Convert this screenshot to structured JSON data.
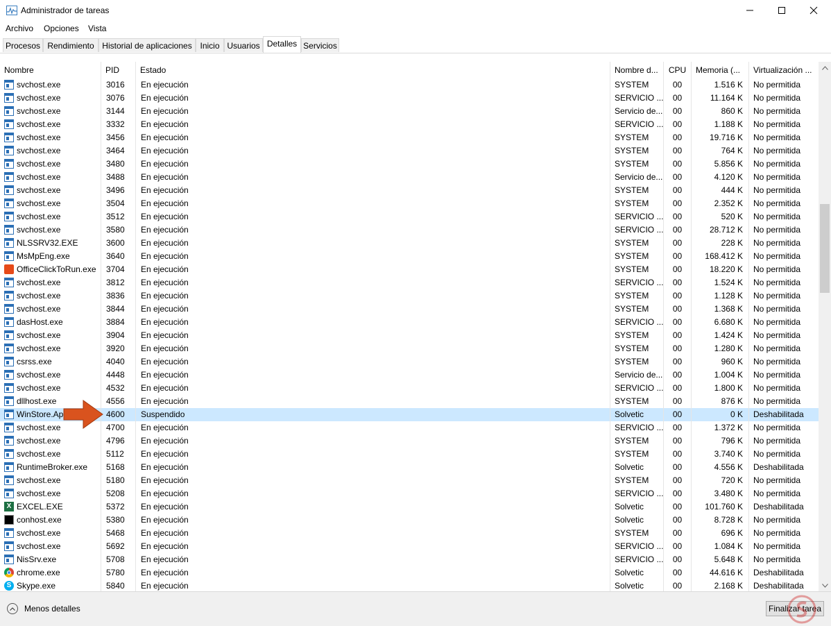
{
  "window": {
    "title": "Administrador de tareas",
    "minimize_glyph": "—",
    "maximize_glyph": "☐",
    "close_glyph": "✕"
  },
  "menu": [
    "Archivo",
    "Opciones",
    "Vista"
  ],
  "tabs": [
    {
      "label": "Procesos"
    },
    {
      "label": "Rendimiento"
    },
    {
      "label": "Historial de aplicaciones"
    },
    {
      "label": "Inicio"
    },
    {
      "label": "Usuarios"
    },
    {
      "label": "Detalles",
      "active": true
    },
    {
      "label": "Servicios"
    }
  ],
  "columns": {
    "name": "Nombre",
    "pid": "PID",
    "state": "Estado",
    "user": "Nombre d...",
    "cpu": "CPU",
    "memory": "Memoria (...",
    "virtualization": "Virtualización ..."
  },
  "rows": [
    {
      "name": "svchost.exe",
      "icon": "window",
      "pid": "3016",
      "state": "En ejecución",
      "user": "SYSTEM",
      "cpu": "00",
      "memory": "1.516 K",
      "virt": "No permitida"
    },
    {
      "name": "svchost.exe",
      "icon": "window",
      "pid": "3076",
      "state": "En ejecución",
      "user": "SERVICIO ...",
      "cpu": "00",
      "memory": "11.164 K",
      "virt": "No permitida"
    },
    {
      "name": "svchost.exe",
      "icon": "window",
      "pid": "3144",
      "state": "En ejecución",
      "user": "Servicio de...",
      "cpu": "00",
      "memory": "860 K",
      "virt": "No permitida"
    },
    {
      "name": "svchost.exe",
      "icon": "window",
      "pid": "3332",
      "state": "En ejecución",
      "user": "SERVICIO ...",
      "cpu": "00",
      "memory": "1.188 K",
      "virt": "No permitida"
    },
    {
      "name": "svchost.exe",
      "icon": "window",
      "pid": "3456",
      "state": "En ejecución",
      "user": "SYSTEM",
      "cpu": "00",
      "memory": "19.716 K",
      "virt": "No permitida"
    },
    {
      "name": "svchost.exe",
      "icon": "window",
      "pid": "3464",
      "state": "En ejecución",
      "user": "SYSTEM",
      "cpu": "00",
      "memory": "764 K",
      "virt": "No permitida"
    },
    {
      "name": "svchost.exe",
      "icon": "window",
      "pid": "3480",
      "state": "En ejecución",
      "user": "SYSTEM",
      "cpu": "00",
      "memory": "5.856 K",
      "virt": "No permitida"
    },
    {
      "name": "svchost.exe",
      "icon": "window",
      "pid": "3488",
      "state": "En ejecución",
      "user": "Servicio de...",
      "cpu": "00",
      "memory": "4.120 K",
      "virt": "No permitida"
    },
    {
      "name": "svchost.exe",
      "icon": "window",
      "pid": "3496",
      "state": "En ejecución",
      "user": "SYSTEM",
      "cpu": "00",
      "memory": "444 K",
      "virt": "No permitida"
    },
    {
      "name": "svchost.exe",
      "icon": "window",
      "pid": "3504",
      "state": "En ejecución",
      "user": "SYSTEM",
      "cpu": "00",
      "memory": "2.352 K",
      "virt": "No permitida"
    },
    {
      "name": "svchost.exe",
      "icon": "window",
      "pid": "3512",
      "state": "En ejecución",
      "user": "SERVICIO ...",
      "cpu": "00",
      "memory": "520 K",
      "virt": "No permitida"
    },
    {
      "name": "svchost.exe",
      "icon": "window",
      "pid": "3580",
      "state": "En ejecución",
      "user": "SERVICIO ...",
      "cpu": "00",
      "memory": "28.712 K",
      "virt": "No permitida"
    },
    {
      "name": "NLSSRV32.EXE",
      "icon": "window",
      "pid": "3600",
      "state": "En ejecución",
      "user": "SYSTEM",
      "cpu": "00",
      "memory": "228 K",
      "virt": "No permitida"
    },
    {
      "name": "MsMpEng.exe",
      "icon": "window",
      "pid": "3640",
      "state": "En ejecución",
      "user": "SYSTEM",
      "cpu": "00",
      "memory": "168.412 K",
      "virt": "No permitida"
    },
    {
      "name": "OfficeClickToRun.exe",
      "icon": "office",
      "pid": "3704",
      "state": "En ejecución",
      "user": "SYSTEM",
      "cpu": "00",
      "memory": "18.220 K",
      "virt": "No permitida"
    },
    {
      "name": "svchost.exe",
      "icon": "window",
      "pid": "3812",
      "state": "En ejecución",
      "user": "SERVICIO ...",
      "cpu": "00",
      "memory": "1.524 K",
      "virt": "No permitida"
    },
    {
      "name": "svchost.exe",
      "icon": "window",
      "pid": "3836",
      "state": "En ejecución",
      "user": "SYSTEM",
      "cpu": "00",
      "memory": "1.128 K",
      "virt": "No permitida"
    },
    {
      "name": "svchost.exe",
      "icon": "window",
      "pid": "3844",
      "state": "En ejecución",
      "user": "SYSTEM",
      "cpu": "00",
      "memory": "1.368 K",
      "virt": "No permitida"
    },
    {
      "name": "dasHost.exe",
      "icon": "window",
      "pid": "3884",
      "state": "En ejecución",
      "user": "SERVICIO ...",
      "cpu": "00",
      "memory": "6.680 K",
      "virt": "No permitida"
    },
    {
      "name": "svchost.exe",
      "icon": "window",
      "pid": "3904",
      "state": "En ejecución",
      "user": "SYSTEM",
      "cpu": "00",
      "memory": "1.424 K",
      "virt": "No permitida"
    },
    {
      "name": "svchost.exe",
      "icon": "window",
      "pid": "3920",
      "state": "En ejecución",
      "user": "SYSTEM",
      "cpu": "00",
      "memory": "1.280 K",
      "virt": "No permitida"
    },
    {
      "name": "csrss.exe",
      "icon": "window",
      "pid": "4040",
      "state": "En ejecución",
      "user": "SYSTEM",
      "cpu": "00",
      "memory": "960 K",
      "virt": "No permitida"
    },
    {
      "name": "svchost.exe",
      "icon": "window",
      "pid": "4448",
      "state": "En ejecución",
      "user": "Servicio de...",
      "cpu": "00",
      "memory": "1.004 K",
      "virt": "No permitida"
    },
    {
      "name": "svchost.exe",
      "icon": "window",
      "pid": "4532",
      "state": "En ejecución",
      "user": "SERVICIO ...",
      "cpu": "00",
      "memory": "1.800 K",
      "virt": "No permitida"
    },
    {
      "name": "dllhost.exe",
      "icon": "window",
      "pid": "4556",
      "state": "En ejecución",
      "user": "SYSTEM",
      "cpu": "00",
      "memory": "876 K",
      "virt": "No permitida"
    },
    {
      "name": "WinStore.App.exe",
      "icon": "window",
      "pid": "4600",
      "state": "Suspendido",
      "user": "Solvetic",
      "cpu": "00",
      "memory": "0 K",
      "virt": "Deshabilitada",
      "selected": true
    },
    {
      "name": "svchost.exe",
      "icon": "window",
      "pid": "4700",
      "state": "En ejecución",
      "user": "SERVICIO ...",
      "cpu": "00",
      "memory": "1.372 K",
      "virt": "No permitida"
    },
    {
      "name": "svchost.exe",
      "icon": "window",
      "pid": "4796",
      "state": "En ejecución",
      "user": "SYSTEM",
      "cpu": "00",
      "memory": "796 K",
      "virt": "No permitida"
    },
    {
      "name": "svchost.exe",
      "icon": "window",
      "pid": "5112",
      "state": "En ejecución",
      "user": "SYSTEM",
      "cpu": "00",
      "memory": "3.740 K",
      "virt": "No permitida"
    },
    {
      "name": "RuntimeBroker.exe",
      "icon": "window",
      "pid": "5168",
      "state": "En ejecución",
      "user": "Solvetic",
      "cpu": "00",
      "memory": "4.556 K",
      "virt": "Deshabilitada"
    },
    {
      "name": "svchost.exe",
      "icon": "window",
      "pid": "5180",
      "state": "En ejecución",
      "user": "SYSTEM",
      "cpu": "00",
      "memory": "720 K",
      "virt": "No permitida"
    },
    {
      "name": "svchost.exe",
      "icon": "window",
      "pid": "5208",
      "state": "En ejecución",
      "user": "SERVICIO ...",
      "cpu": "00",
      "memory": "3.480 K",
      "virt": "No permitida"
    },
    {
      "name": "EXCEL.EXE",
      "icon": "excel",
      "pid": "5372",
      "state": "En ejecución",
      "user": "Solvetic",
      "cpu": "00",
      "memory": "101.760 K",
      "virt": "Deshabilitada"
    },
    {
      "name": "conhost.exe",
      "icon": "console",
      "pid": "5380",
      "state": "En ejecución",
      "user": "Solvetic",
      "cpu": "00",
      "memory": "8.728 K",
      "virt": "No permitida"
    },
    {
      "name": "svchost.exe",
      "icon": "window",
      "pid": "5468",
      "state": "En ejecución",
      "user": "SYSTEM",
      "cpu": "00",
      "memory": "696 K",
      "virt": "No permitida"
    },
    {
      "name": "svchost.exe",
      "icon": "window",
      "pid": "5692",
      "state": "En ejecución",
      "user": "SERVICIO ...",
      "cpu": "00",
      "memory": "1.084 K",
      "virt": "No permitida"
    },
    {
      "name": "NisSrv.exe",
      "icon": "window",
      "pid": "5708",
      "state": "En ejecución",
      "user": "SERVICIO ...",
      "cpu": "00",
      "memory": "5.648 K",
      "virt": "No permitida"
    },
    {
      "name": "chrome.exe",
      "icon": "chrome",
      "pid": "5780",
      "state": "En ejecución",
      "user": "Solvetic",
      "cpu": "00",
      "memory": "44.616 K",
      "virt": "Deshabilitada"
    },
    {
      "name": "Skype.exe",
      "icon": "skype",
      "pid": "5840",
      "state": "En ejecución",
      "user": "Solvetic",
      "cpu": "00",
      "memory": "2.168 K",
      "virt": "Deshabilitada"
    }
  ],
  "footer": {
    "less_details": "Menos detalles",
    "end_task": "Finalizar tarea"
  },
  "colors": {
    "selection": "#cce8ff",
    "annotation_arrow": "#d9531e"
  }
}
